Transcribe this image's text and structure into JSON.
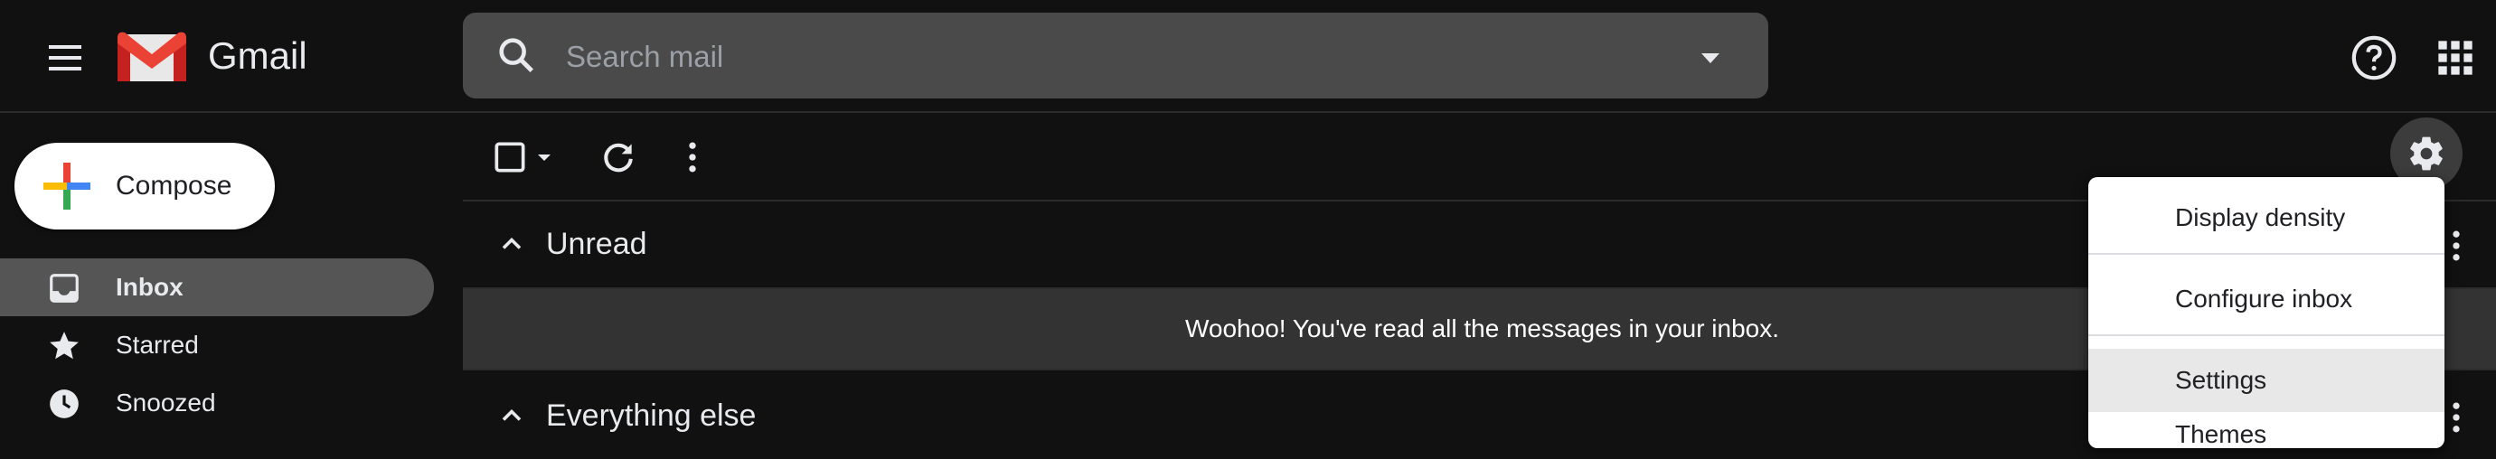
{
  "header": {
    "app_title": "Gmail",
    "search": {
      "placeholder": "Search mail",
      "value": ""
    },
    "icons": [
      "menu-icon",
      "gmail-logo",
      "search-icon",
      "search-options-icon",
      "help-icon",
      "apps-icon"
    ]
  },
  "compose": {
    "label": "Compose"
  },
  "sidebar": {
    "items": [
      {
        "label": "Inbox",
        "icon": "inbox-icon",
        "active": true
      },
      {
        "label": "Starred",
        "icon": "star-icon",
        "active": false
      },
      {
        "label": "Snoozed",
        "icon": "clock-icon",
        "active": false
      }
    ]
  },
  "toolbar": {
    "icons": [
      "select-checkbox",
      "select-dropdown-icon",
      "refresh-icon",
      "more-vert-icon"
    ]
  },
  "sections": {
    "unread": {
      "title": "Unread",
      "empty_message": "Woohoo! You've read all the messages in your inbox."
    },
    "everything_else": {
      "title": "Everything else"
    }
  },
  "settings_menu": {
    "items": [
      {
        "label": "Display density"
      },
      {
        "label": "Configure inbox"
      },
      {
        "label": "Settings",
        "highlighted": true
      },
      {
        "label": "Themes"
      }
    ]
  },
  "colors": {
    "background": "#111111",
    "search_bg": "#4a4a4a",
    "active_nav": "#555555",
    "gmail_red": "#ea4335",
    "compose_bg": "#ffffff"
  }
}
